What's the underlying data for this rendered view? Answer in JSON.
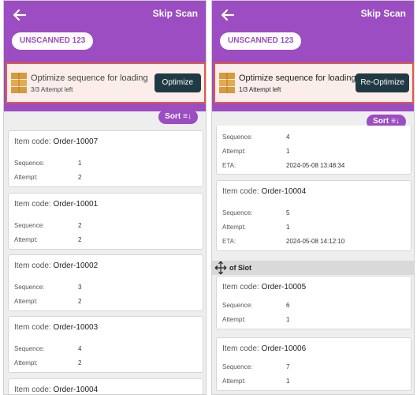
{
  "left": {
    "header": {
      "skip_scan": "Skip Scan",
      "unscanned": "UNSCANNED 123"
    },
    "optimize": {
      "title": "Optimize sequence for loading",
      "subtitle": "3/3 Attempt left",
      "button": "Optimize"
    },
    "sort": {
      "label": "Sort"
    },
    "cards": [
      {
        "prefix": "Item code:",
        "code": "Order-10007",
        "sequence_label": "Sequence:",
        "sequence": "1",
        "attempt_label": "Attempt:",
        "attempt": "2"
      },
      {
        "prefix": "Item code:",
        "code": "Order-10001",
        "sequence_label": "Sequence:",
        "sequence": "2",
        "attempt_label": "Attempt:",
        "attempt": "2"
      },
      {
        "prefix": "Item code:",
        "code": "Order-10002",
        "sequence_label": "Sequence:",
        "sequence": "3",
        "attempt_label": "Attempt:",
        "attempt": "2"
      },
      {
        "prefix": "Item code:",
        "code": "Order-10003",
        "sequence_label": "Sequence:",
        "sequence": "4",
        "attempt_label": "Attempt:",
        "attempt": "2"
      },
      {
        "prefix": "Item code:",
        "code": "Order-10004"
      }
    ]
  },
  "right": {
    "header": {
      "skip_scan": "Skip Scan",
      "unscanned": "UNSCANNED 123"
    },
    "optimize": {
      "title": "Optimize sequence for loading",
      "subtitle": "1/3 Attempt left",
      "button": "Re-Optimize"
    },
    "sort": {
      "label": "Sort"
    },
    "partial_card": {
      "sequence_label": "Sequence:",
      "sequence": "4",
      "attempt_label": "Attempt:",
      "attempt": "1",
      "eta_label": "ETA:",
      "eta": "2024-05-08 13:48:34"
    },
    "card_10004": {
      "prefix": "Item code:",
      "code": "Order-10004",
      "sequence_label": "Sequence:",
      "sequence": "5",
      "attempt_label": "Attempt:",
      "attempt": "1",
      "eta_label": "ETA:",
      "eta": "2024-05-08 14:12:10"
    },
    "slot_header": "of Slot",
    "cards_after": [
      {
        "prefix": "Item code:",
        "code": "Order-10005",
        "sequence_label": "Sequence:",
        "sequence": "6",
        "attempt_label": "Attempt:",
        "attempt": "1"
      },
      {
        "prefix": "Item code:",
        "code": "Order-10006",
        "sequence_label": "Sequence:",
        "sequence": "7",
        "attempt_label": "Attempt:",
        "attempt": "1"
      }
    ]
  },
  "colors": {
    "purple": "#9b4dc1",
    "dark_button": "#1f3a44",
    "highlight_border": "#e05a4a"
  },
  "icons": {
    "back": "arrow-left-icon",
    "boxes": "stacked-boxes-icon",
    "sort": "sort-icon",
    "cursor": "move-cursor-icon"
  }
}
